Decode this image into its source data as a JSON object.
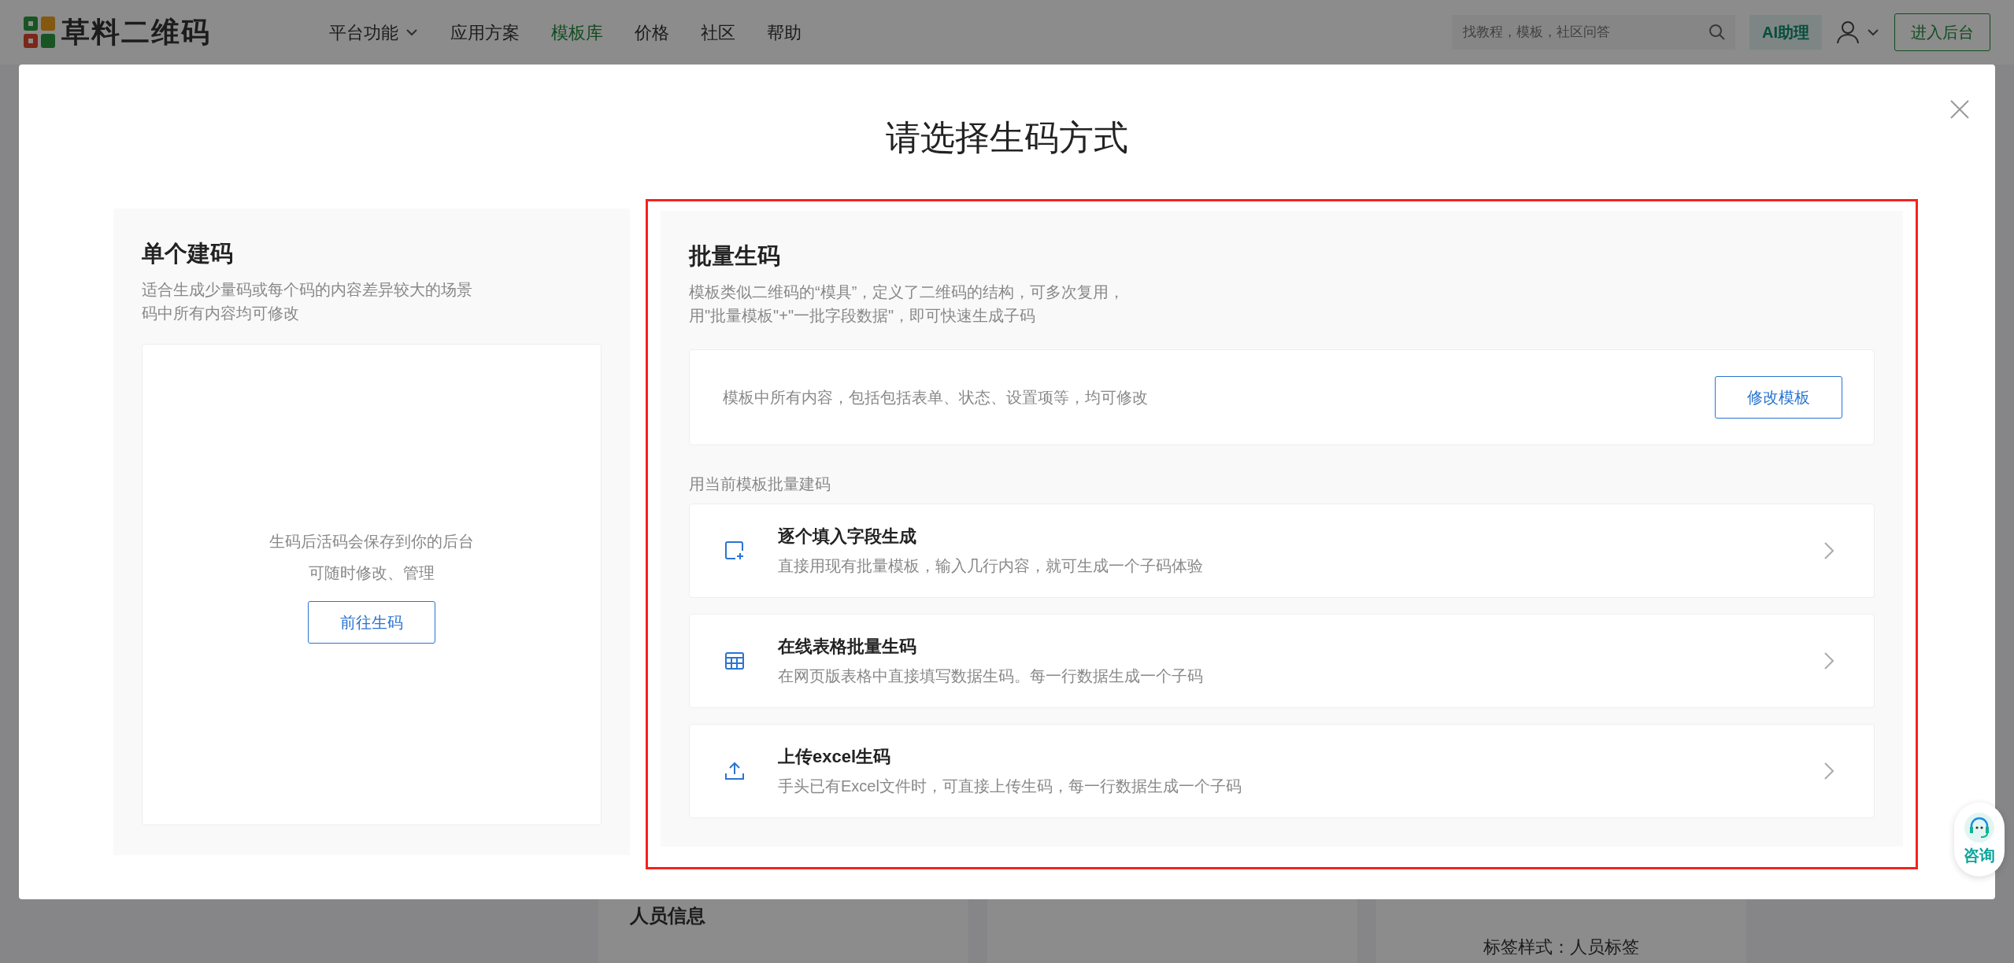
{
  "header": {
    "logo": "草料二维码",
    "nav": [
      {
        "label": "平台功能",
        "has_menu": true,
        "selected": false
      },
      {
        "label": "应用方案",
        "has_menu": false,
        "selected": false
      },
      {
        "label": "模板库",
        "has_menu": false,
        "selected": true
      },
      {
        "label": "价格",
        "has_menu": false,
        "selected": false
      },
      {
        "label": "社区",
        "has_menu": false,
        "selected": false
      },
      {
        "label": "帮助",
        "has_menu": false,
        "selected": false
      }
    ],
    "search": {
      "placeholder": "找教程，模板，社区问答"
    },
    "ai_button": "AI助理",
    "enter_button": "进入后台"
  },
  "background": {
    "card_title": "人员信息",
    "label_style": "标签样式：人员标签"
  },
  "dialog": {
    "title": "请选择生码方式",
    "single": {
      "title": "单个建码",
      "description": [
        "适合生成少量码或每个码的内容差异较大的场景",
        "码中所有内容均可修改"
      ],
      "note": [
        "生码后活码会保存到你的后台",
        "可随时修改、管理"
      ],
      "button": "前往生码"
    },
    "batch": {
      "highlighted": true,
      "title": "批量生码",
      "description": [
        "模板类似二维码的“模具”，定义了二维码的结构，可多次复用，",
        "用\"批量模板\"+\"一批字段数据\"，即可快速生成子码"
      ],
      "template_note": "模板中所有内容，包括包括表单、状态、设置项等，均可修改",
      "template_button": "修改模板",
      "section_label": "用当前模板批量建码",
      "options": [
        {
          "kind": "fill",
          "title": "逐个填入字段生成",
          "description": "直接用现有批量模板，输入几行内容，就可生成一个子码体验"
        },
        {
          "kind": "table",
          "title": "在线表格批量生码",
          "description": "在网页版表格中直接填写数据生码。每一行数据生成一个子码"
        },
        {
          "kind": "upload",
          "title": "上传excel生码",
          "description": "手头已有Excel文件时，可直接上传生码，每一行数据生成一个子码"
        }
      ]
    }
  },
  "consult": "咨询"
}
